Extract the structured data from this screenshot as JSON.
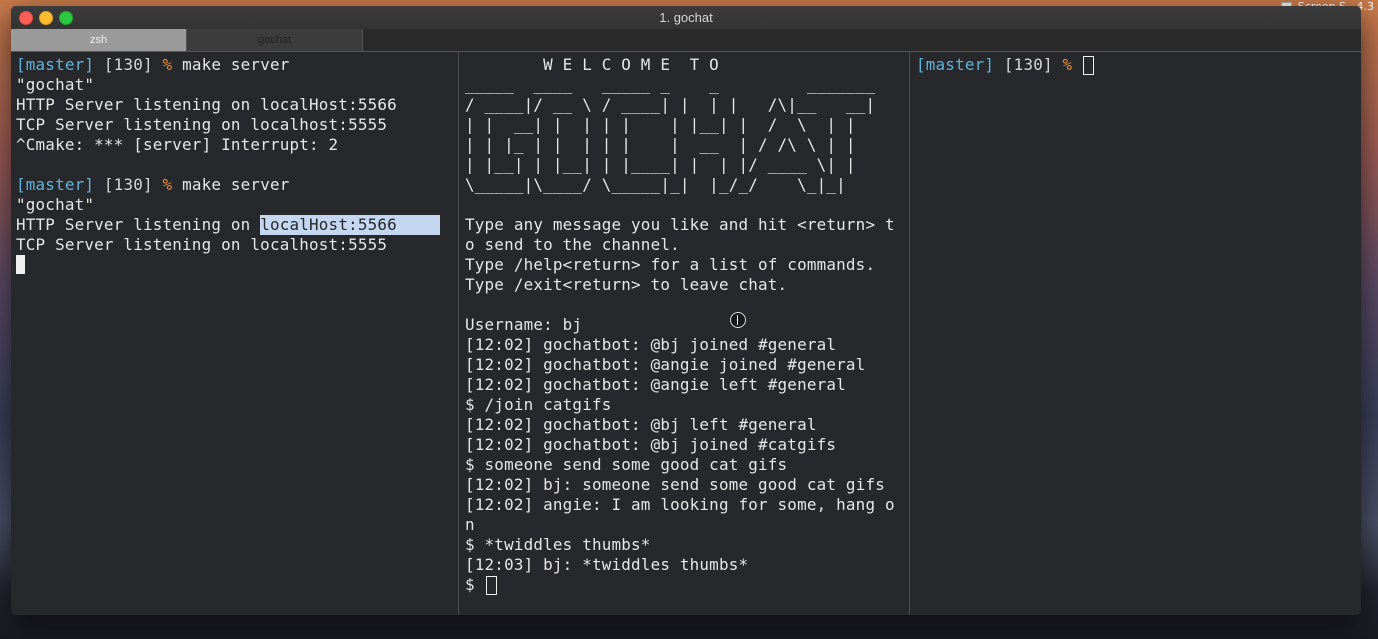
{
  "desktop": {
    "corner_label": "Screen S...4.3"
  },
  "window": {
    "title": "1. gochat"
  },
  "tabs": [
    {
      "label": "zsh"
    },
    {
      "label": "gochat"
    }
  ],
  "left_pane": {
    "lines": [
      {
        "branch": "[master]",
        "code": " [130] ",
        "pct": "%",
        "text": " make server"
      },
      {
        "text": "\"gochat\""
      },
      {
        "text": "HTTP Server listening on localHost:5566"
      },
      {
        "text": "TCP Server listening on localhost:5555"
      },
      {
        "text": "^Cmake: *** [server] Interrupt: 2"
      },
      {
        "text": ""
      },
      {
        "branch": "[master]",
        "code": " [130] ",
        "pct": "%",
        "text": " make server"
      },
      {
        "text": "\"gochat\""
      },
      {
        "text": "HTTP Server listening on ",
        "highlight": "localHost:5566"
      },
      {
        "text": "TCP Server listening on localhost:5555"
      }
    ]
  },
  "middle_pane": {
    "banner_title": "        W E L C O M E  T O",
    "ascii_art": [
      "_____  ____   _____ _    _         _______",
      "/ ____|/ __ \\ / ____| |  | |   /\\|__   __|",
      "| |  __| |  | | |    | |__| |  /  \\  | |",
      "| | |_ | |  | | |    |  __  | / /\\ \\ | |",
      "| |__| | |__| | |____| |  | |/ ____ \\| |",
      "\\_____|\\____/ \\_____|_|  |_/_/    \\_|_|"
    ],
    "intro": [
      "Type any message you like and hit <return> t",
      "o send to the channel.",
      "Type /help<return> for a list of commands.",
      "Type /exit<return> to leave chat.",
      ""
    ],
    "chat": [
      "Username: bj",
      "[12:02] gochatbot: @bj joined #general",
      "[12:02] gochatbot: @angie joined #general",
      "[12:02] gochatbot: @angie left #general",
      "$ /join catgifs",
      "[12:02] gochatbot: @bj left #general",
      "[12:02] gochatbot: @bj joined #catgifs",
      "$ someone send some good cat gifs",
      "[12:02] bj: someone send some good cat gifs",
      "[12:02] angie: I am looking for some, hang o",
      "n",
      "$ *twiddles thumbs*",
      "[12:03] bj: *twiddles thumbs*"
    ],
    "prompt": "$ "
  },
  "right_pane": {
    "branch": "[master]",
    "code": " [130] ",
    "pct": "%"
  },
  "colors": {
    "branch": "#5fb3d8",
    "percent": "#e78a36",
    "terminal_bg": "#26282b",
    "selection": "#c5d7f0"
  }
}
